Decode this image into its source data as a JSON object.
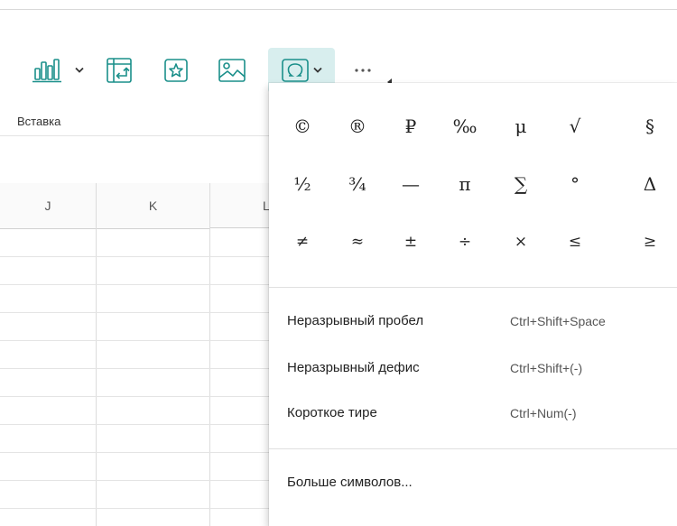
{
  "toolbar": {
    "buttons": [
      {
        "name": "chart-button",
        "icon": "bar-chart-icon",
        "has_dropdown": true
      },
      {
        "name": "pivot-table-button",
        "icon": "pivot-table-icon"
      },
      {
        "name": "shape-button",
        "icon": "star-shape-icon"
      },
      {
        "name": "image-button",
        "icon": "image-icon"
      },
      {
        "name": "symbol-button",
        "icon": "omega-icon",
        "has_dropdown": true,
        "active": true
      },
      {
        "name": "more-button",
        "icon": "more-dots-icon"
      }
    ],
    "accent_color": "#1a8f8a",
    "active_bg": "#d8eeee"
  },
  "ribbon": {
    "section_label": "Вставка"
  },
  "grid": {
    "columns": [
      "J",
      "K",
      "L"
    ]
  },
  "symbol_menu": {
    "symbols": [
      [
        "©",
        "®",
        "₽",
        "‰",
        "μ",
        "√",
        "§"
      ],
      [
        "½",
        "¾",
        "—",
        "π",
        "∑",
        "°",
        "Δ"
      ],
      [
        "≠",
        "≈",
        "±",
        "÷",
        "×",
        "≤",
        "≥"
      ]
    ],
    "items": [
      {
        "label": "Неразрывный пробел",
        "shortcut": "Ctrl+Shift+Space"
      },
      {
        "label": "Неразрывный дефис",
        "shortcut": "Ctrl+Shift+(-)"
      },
      {
        "label": "Короткое тире",
        "shortcut": "Ctrl+Num(-)"
      }
    ],
    "more_label": "Больше символов..."
  }
}
